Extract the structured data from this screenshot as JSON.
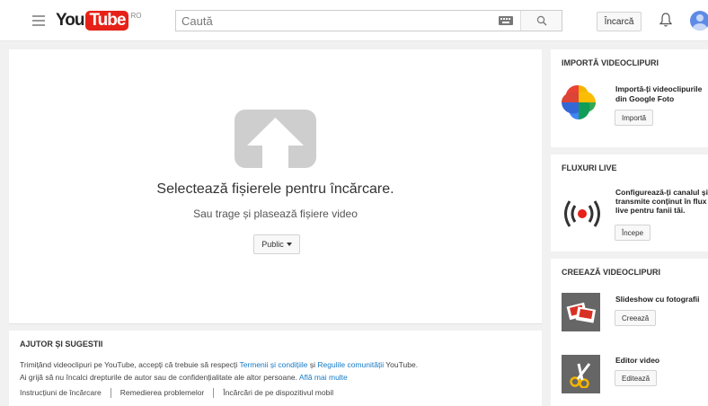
{
  "header": {
    "logo_you": "You",
    "logo_tube": "Tube",
    "logo_region": "RO",
    "search_placeholder": "Caută",
    "upload_label": "Încarcă"
  },
  "upload": {
    "select_text": "Selectează fișierele pentru încărcare.",
    "drag_text": "Sau trage și plasează fișiere video",
    "privacy_label": "Public"
  },
  "help": {
    "title": "AJUTOR ȘI SUGESTII",
    "line1_pre": "Trimițând videoclipuri pe YouTube, accepți că trebuie să respecți ",
    "terms_link": "Termenii și condițiile",
    "line1_mid": " și ",
    "community_link": "Regulile comunității",
    "line1_post": " YouTube.",
    "line2_pre": "Ai grijă să nu încalci drepturile de autor sau de confidențialitate ale altor persoane. ",
    "learn_more_link": "Află mai multe",
    "links": [
      "Instrucțiuni de încărcare",
      "Remedierea problemelor",
      "Încărcări de pe dispozitivul mobil"
    ]
  },
  "sidebar": {
    "import": {
      "title": "IMPORTĂ VIDEOCLIPURI",
      "text_line1": "Importă-ți videoclipurile",
      "text_line2": "din Google Foto",
      "button": "Importă"
    },
    "live": {
      "title": "FLUXURI LIVE",
      "text_line1": "Configurează-ți canalul și",
      "text_line2": "transmite conținut în flux",
      "text_line3": "live pentru fanii tăi.",
      "button": "Începe"
    },
    "create": {
      "title": "CREEAZĂ VIDEOCLIPURI",
      "slideshow_label": "Slideshow cu fotografii",
      "slideshow_button": "Creează",
      "editor_label": "Editor video",
      "editor_button": "Editează"
    }
  },
  "colors": {
    "brand_red": "#e62117",
    "link_blue": "#167ac6",
    "live_red": "#e62117"
  }
}
